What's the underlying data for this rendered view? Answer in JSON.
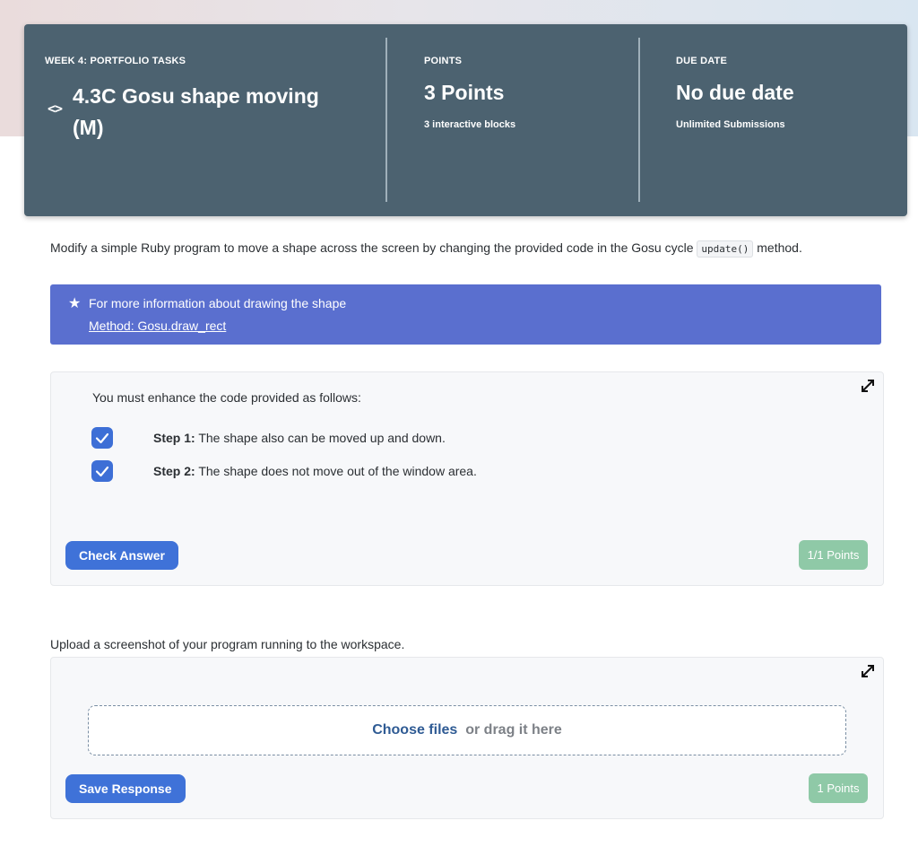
{
  "header": {
    "section_label": "WEEK 4: PORTFOLIO TASKS",
    "task_title": "4.3C Gosu shape moving (M)",
    "type_icon": "code-icon",
    "points_label": "POINTS",
    "points_value": "3 Points",
    "points_sub": "3 interactive blocks",
    "due_label": "DUE DATE",
    "due_value": "No due date",
    "due_sub": "Unlimited Submissions",
    "background_color": "#4c6270"
  },
  "intro": {
    "before": "Modify a simple Ruby program to move a shape across the screen by changing the provided code in the Gosu cycle",
    "code": "update()",
    "after": "method."
  },
  "info_banner": {
    "icon": "star-icon",
    "text": "For more information about drawing the shape",
    "link_text": "Method: Gosu.draw_rect",
    "color": "#5a6fcf"
  },
  "quiz_block": {
    "heading": "You must enhance the code provided as follows:",
    "steps": [
      {
        "label": "Step 1:",
        "text": "The shape also can be moved up and down.",
        "checked": true
      },
      {
        "label": "Step 2:",
        "text": "The shape does not move out of the window area.",
        "checked": true
      }
    ],
    "button_label": "Check Answer",
    "points_badge": "1/1 Points"
  },
  "upload_block": {
    "label": "Upload a screenshot of your program running to the workspace.",
    "choose_files": "Choose files",
    "drag_text": "or drag it here",
    "button_label": "Save Response",
    "points_badge": "1 Points"
  },
  "colors": {
    "primary_button": "#3f72d8",
    "points_badge": "#8fc9a7",
    "checkbox": "#3d6fd6"
  }
}
